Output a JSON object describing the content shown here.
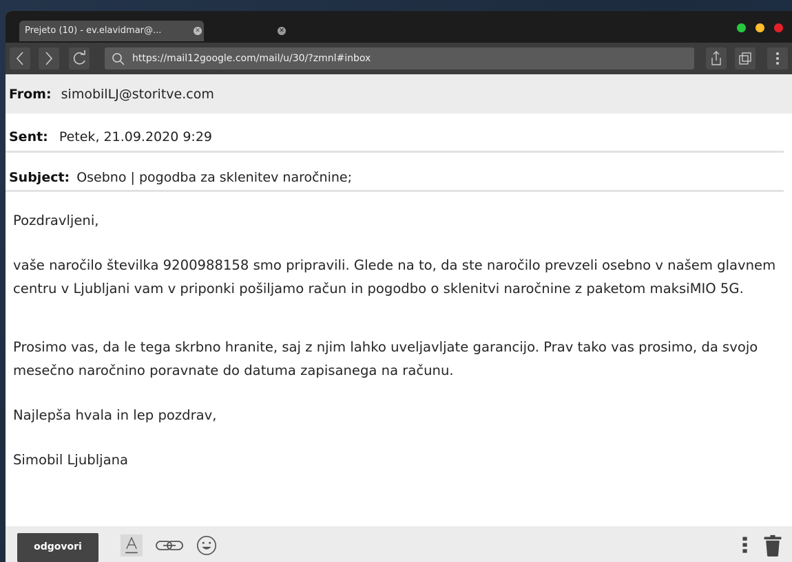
{
  "browser": {
    "tab_title": "Prejeto (10) - ev.elavidmar@...",
    "url": "https://mail12google.com/mail/u/30/?zmnl#inbox",
    "colors": {
      "traffic_green": "#27c93f",
      "traffic_yellow": "#ffbd2e",
      "traffic_red": "#e5202a"
    }
  },
  "email": {
    "from_label": "From:",
    "from_value": "simobilLJ@storitve.com",
    "sent_label": "Sent:",
    "sent_value": "Petek, 21.09.2020 9:29",
    "subject_label": "Subject:",
    "subject_value": "Osebno | pogodba za sklenitev naročnine;",
    "body": {
      "greeting": "Pozdravljeni,",
      "para1": "vaše naročilo številka 9200988158 smo pripravili. Glede na to, da ste naročilo prevzeli osebno v našem glavnem centru v Ljubljani vam v priponki pošiljamo račun in pogodbo o sklenitvi naročnine z paketom maksiMIO 5G.",
      "para2": "Prosimo vas, da le tega skrbno hranite, saj z njim lahko uveljavljate garancijo. Prav tako vas prosimo, da svojo mesečno naročnino poravnate do datuma zapisanega na računu.",
      "closing": "Najlepša hvala in lep pozdrav,",
      "signature": "Simobil Ljubljana"
    }
  },
  "actions": {
    "reply_label": "odgovori",
    "icons": [
      "text-format-icon",
      "link-icon",
      "emoji-icon",
      "more-vert-icon",
      "trash-icon"
    ]
  }
}
